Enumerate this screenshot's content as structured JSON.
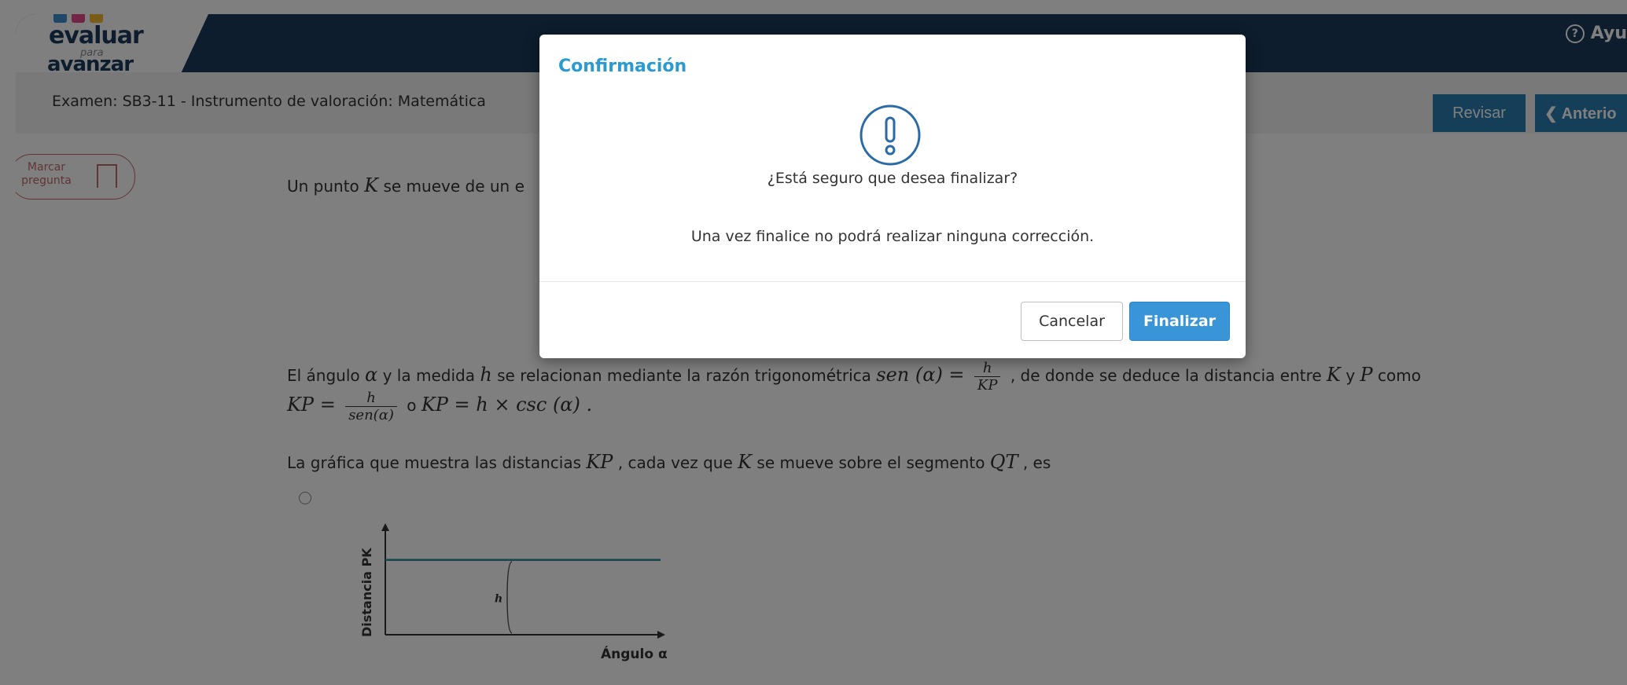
{
  "header": {
    "logo": {
      "line1": "evaluar",
      "line2": "para",
      "line3": "avanzar",
      "colors": [
        "#3c8fd1",
        "#e64b8b",
        "#f2b830"
      ]
    },
    "help_label": "Ayu",
    "help_icon": "help-circle-icon"
  },
  "subbar": {
    "exam_title": "Examen: SB3-11 - Instrumento de valoración: Matemática",
    "revisar_label": "Revisar",
    "anterior_label": "Anterio"
  },
  "question": {
    "marcar_label_1": "Marcar",
    "marcar_label_2": "pregunta",
    "intro_text": "Un punto",
    "intro_var": "K",
    "intro_tail": "se mueve de un e",
    "p2_a": "El ángulo",
    "alpha": "α",
    "p2_b": "y la medida",
    "h": "h",
    "p2_c": "se relacionan mediante la razón trigonométrica",
    "sen_alpha": "sen (α) =",
    "frac1_num": "h",
    "frac1_den": "KP",
    "p2_d": ", de donde se deduce la distancia entre",
    "K": "K",
    "y": "y",
    "P": "P",
    "como": "como",
    "kp_eq": "KP =",
    "frac2_num": "h",
    "frac2_den": "sen(α)",
    "or": "o",
    "kp_eq2": "KP = h × csc (α) .",
    "p3_a": "La gráfica que muestra las distancias",
    "KP": "KP",
    "p3_b": ", cada vez que",
    "p3_c": "se mueve sobre el segmento",
    "QT": "QT",
    "p3_d": ", es"
  },
  "chart_data": {
    "type": "line",
    "title": "",
    "xlabel": "Ángulo α",
    "ylabel": "Distancia PK",
    "annotation": "h",
    "series": [
      {
        "values": [
          0.7,
          0.7
        ]
      }
    ],
    "ylim": [
      0,
      1
    ],
    "grid": false,
    "line_color": "#2e8b9e"
  },
  "modal": {
    "title": "Confirmación",
    "icon": "exclamation-circle-icon",
    "question": "¿Está seguro que desea finalizar?",
    "note": "Una vez finalice no podrá realizar ninguna corrección.",
    "cancel_label": "Cancelar",
    "finalize_label": "Finalizar",
    "accent_color": "#2a9ad0"
  }
}
